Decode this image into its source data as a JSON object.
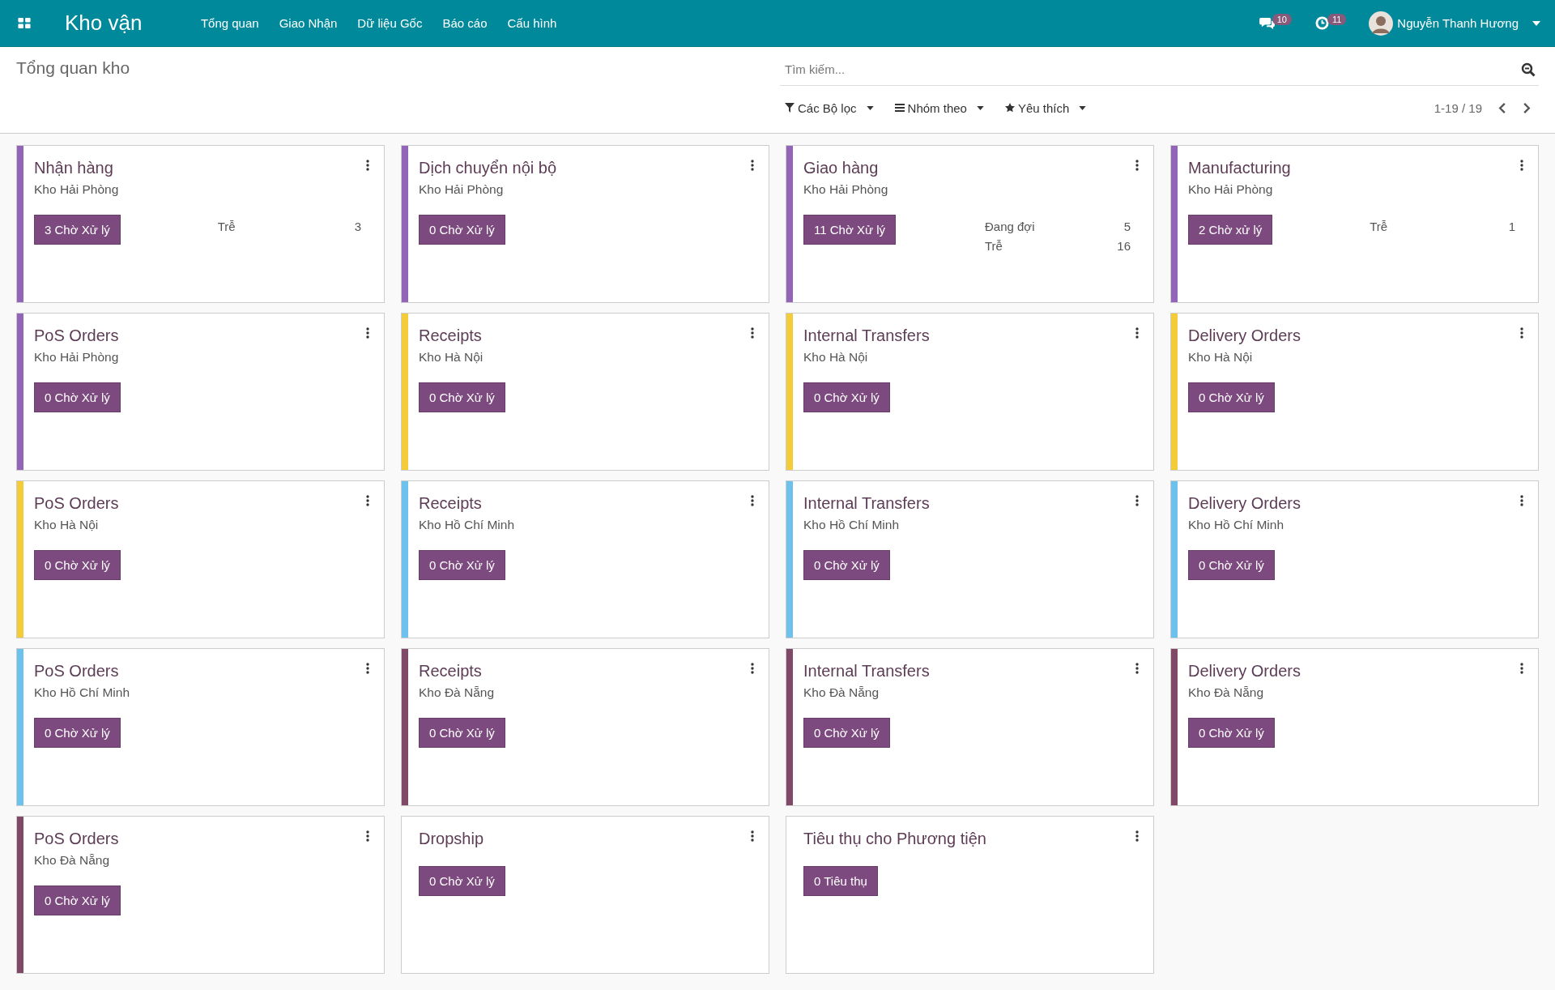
{
  "navbar": {
    "brand": "Kho vận",
    "menu": [
      "Tổng quan",
      "Giao Nhận",
      "Dữ liệu Gốc",
      "Báo cáo",
      "Cấu hình"
    ],
    "messages_count": "10",
    "activities_count": "11",
    "user": "Nguyễn Thanh Hương"
  },
  "control_panel": {
    "title": "Tổng quan kho",
    "search": {
      "placeholder": "Tìm kiếm..."
    },
    "filters": [
      "Các Bộ lọc",
      "Nhóm theo",
      "Yêu thích"
    ],
    "pager": "1-19 / 19"
  },
  "cards": [
    {
      "title": "Nhận hàng",
      "subtitle": "Kho Hải Phòng",
      "button": "3 Chờ Xử lý",
      "color": "#9365b8",
      "stats": [
        {
          "label": "Trễ",
          "value": "3"
        }
      ]
    },
    {
      "title": "Dịch chuyển nội bộ",
      "subtitle": "Kho Hải Phòng",
      "button": "0 Chờ Xử lý",
      "color": "#9365b8"
    },
    {
      "title": "Giao hàng",
      "subtitle": "Kho Hải Phòng",
      "button": "11 Chờ Xử lý",
      "color": "#9365b8",
      "stats": [
        {
          "label": "Đang đợi",
          "value": "5"
        },
        {
          "label": "Trễ",
          "value": "16"
        }
      ]
    },
    {
      "title": "Manufacturing",
      "subtitle": "Kho Hải Phòng",
      "button": "2 Chờ xử lý",
      "color": "#9365b8",
      "stats": [
        {
          "label": "Trễ",
          "value": "1"
        }
      ]
    },
    {
      "title": "PoS Orders",
      "subtitle": "Kho Hải Phòng",
      "button": "0 Chờ Xử lý",
      "color": "#9365b8"
    },
    {
      "title": "Receipts",
      "subtitle": "Kho Hà Nội",
      "button": "0 Chờ Xử lý",
      "color": "#f4cc37"
    },
    {
      "title": "Internal Transfers",
      "subtitle": "Kho Hà Nội",
      "button": "0 Chờ Xử lý",
      "color": "#f4cc37"
    },
    {
      "title": "Delivery Orders",
      "subtitle": "Kho Hà Nội",
      "button": "0 Chờ Xử lý",
      "color": "#f4cc37"
    },
    {
      "title": "PoS Orders",
      "subtitle": "Kho Hà Nội",
      "button": "0 Chờ Xử lý",
      "color": "#f4cc37"
    },
    {
      "title": "Receipts",
      "subtitle": "Kho Hồ Chí Minh",
      "button": "0 Chờ Xử lý",
      "color": "#6cc1ed"
    },
    {
      "title": "Internal Transfers",
      "subtitle": "Kho Hồ Chí Minh",
      "button": "0 Chờ Xử lý",
      "color": "#6cc1ed"
    },
    {
      "title": "Delivery Orders",
      "subtitle": "Kho Hồ Chí Minh",
      "button": "0 Chờ Xử lý",
      "color": "#6cc1ed"
    },
    {
      "title": "PoS Orders",
      "subtitle": "Kho Hồ Chí Minh",
      "button": "0 Chờ Xử lý",
      "color": "#6cc1ed"
    },
    {
      "title": "Receipts",
      "subtitle": "Kho Đà Nẵng",
      "button": "0 Chờ Xử lý",
      "color": "#814968"
    },
    {
      "title": "Internal Transfers",
      "subtitle": "Kho Đà Nẵng",
      "button": "0 Chờ Xử lý",
      "color": "#814968"
    },
    {
      "title": "Delivery Orders",
      "subtitle": "Kho Đà Nẵng",
      "button": "0 Chờ Xử lý",
      "color": "#814968"
    },
    {
      "title": "PoS Orders",
      "subtitle": "Kho Đà Nẵng",
      "button": "0 Chờ Xử lý",
      "color": "#814968"
    },
    {
      "title": "Dropship",
      "button": "0 Chờ Xử lý"
    },
    {
      "title": "Tiêu thụ cho Phương tiện",
      "button": "0 Tiêu thụ"
    }
  ]
}
